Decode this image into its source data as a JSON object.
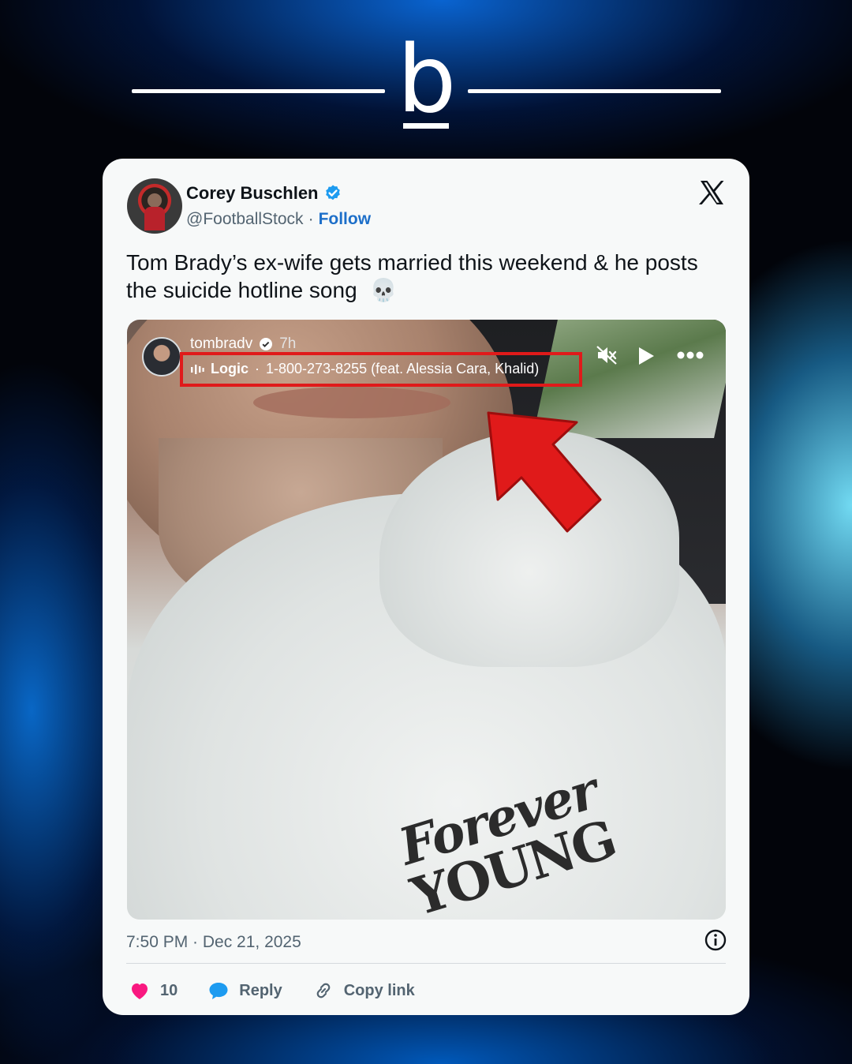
{
  "brand": {
    "letter": "b"
  },
  "tweet": {
    "author": {
      "name": "Corey Buschlen",
      "handle": "@FootballStock",
      "separator": "·",
      "follow_label": "Follow"
    },
    "text_line1": "Tom Brady’s ex-wife gets married this weekend & he posts",
    "text_line2": "the suicide hotline song",
    "emoji": "💀",
    "media": {
      "story_user": "tombradv",
      "story_time": "7h",
      "song_artist": "Logic",
      "song_separator": "·",
      "song_title": "1-800-273-8255 (feat. Alessia Cara, Khalid)",
      "print_line1": "Forever",
      "print_line2": "YOUNG"
    },
    "timestamp": "7:50 PM · Dec 21, 2025",
    "actions": {
      "like_count": "10",
      "reply_label": "Reply",
      "copy_label": "Copy link"
    }
  },
  "colors": {
    "like": "#f91880",
    "reply": "#1d9bf0",
    "follow": "#1d6fc9",
    "highlight_box": "#e01a1a",
    "arrow": "#e01a1a"
  },
  "icons": [
    "verified-badge-icon",
    "x-logo-icon",
    "music-bars-icon",
    "mute-icon",
    "play-icon",
    "more-dots-icon",
    "info-icon",
    "heart-icon",
    "reply-bubble-icon",
    "link-icon"
  ]
}
